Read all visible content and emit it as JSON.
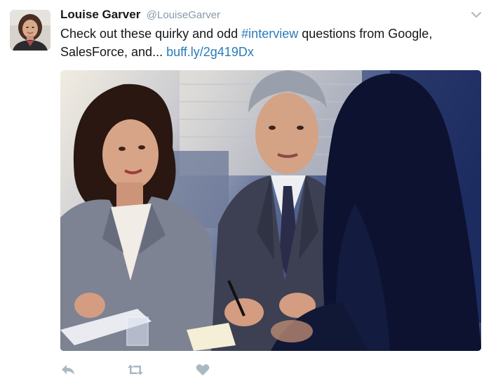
{
  "tweet": {
    "author": {
      "display_name": "Louise Garver",
      "handle": "@LouiseGarver"
    },
    "text": {
      "part1": "Check out these quirky and odd ",
      "hashtag": "#interview",
      "part2": " questions from Google, SalesForce, and... ",
      "link": "buff.ly/2g419Dx"
    },
    "icons": {
      "caret": "chevron-down-icon",
      "reply": "reply-icon",
      "retweet": "retweet-icon",
      "like": "heart-icon"
    },
    "colors": {
      "link": "#2b7bb9",
      "secondary_text": "#8899a6",
      "action_icons": "#aab8c2"
    }
  }
}
